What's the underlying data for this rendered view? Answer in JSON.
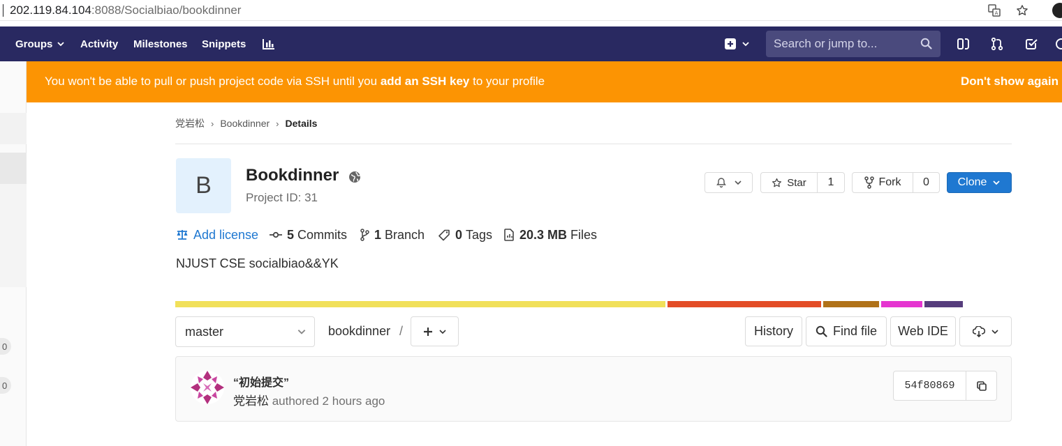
{
  "browser": {
    "url_host": "202.119.84.104",
    "url_rest": ":8088/Socialbiao/bookdinner"
  },
  "nav": {
    "groups_label": "Groups",
    "activity_label": "Activity",
    "milestones_label": "Milestones",
    "snippets_label": "Snippets",
    "search_placeholder": "Search or jump to..."
  },
  "sidebar": {
    "badge_1": "0",
    "badge_2": "0"
  },
  "banner": {
    "text_before": "You won't be able to pull or push project code via SSH until you ",
    "link": "add an SSH key",
    "text_after": " to your profile",
    "dismiss": "Don't show again"
  },
  "breadcrumb": {
    "items": [
      "党岩松",
      "Bookdinner",
      "Details"
    ]
  },
  "project": {
    "avatar_letter": "B",
    "name": "Bookdinner",
    "id_label": "Project ID: 31",
    "star_label": "Star",
    "star_count": "1",
    "fork_label": "Fork",
    "fork_count": "0",
    "clone_label": "Clone",
    "description": "NJUST CSE socialbiao&&YK"
  },
  "stats": {
    "license": "Add license",
    "commits_count": "5",
    "commits_label": "Commits",
    "branch_count": "1",
    "branch_label": "Branch",
    "tags_count": "0",
    "tags_label": "Tags",
    "files_size": "20.3 MB",
    "files_label": "Files"
  },
  "languages": [
    {
      "color": "#f1e05a",
      "share": 58.6
    },
    {
      "color": "#e34c26",
      "share": 18.4
    },
    {
      "color": "#b07219",
      "share": 6.7
    },
    {
      "color": "#e535d0",
      "share": 4.9
    },
    {
      "color": "#563d7c",
      "share": 4.6
    }
  ],
  "tree": {
    "branch": "master",
    "path": "bookdinner",
    "path_sep": "/",
    "history_label": "History",
    "find_file_label": "Find file",
    "web_ide_label": "Web IDE"
  },
  "commit": {
    "title": "“初始提交”",
    "author": "党岩松",
    "meta": " authored 2 hours ago",
    "sha": "54f80869"
  }
}
